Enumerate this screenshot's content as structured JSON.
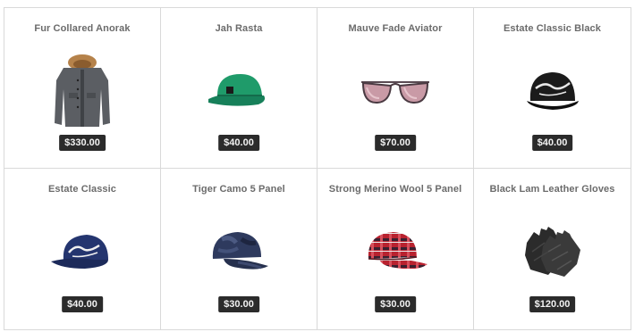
{
  "products": [
    {
      "name": "Fur Collared Anorak",
      "price": "$330.00",
      "icon": "anorak-jacket-icon"
    },
    {
      "name": "Jah Rasta",
      "price": "$40.00",
      "icon": "green-cap-icon"
    },
    {
      "name": "Mauve Fade Aviator",
      "price": "$70.00",
      "icon": "sunglasses-icon"
    },
    {
      "name": "Estate Classic Black",
      "price": "$40.00",
      "icon": "black-cap-icon"
    },
    {
      "name": "Estate Classic",
      "price": "$40.00",
      "icon": "blue-cap-icon"
    },
    {
      "name": "Tiger Camo 5 Panel",
      "price": "$30.00",
      "icon": "camo-cap-icon"
    },
    {
      "name": "Strong Merino Wool 5 Panel",
      "price": "$30.00",
      "icon": "plaid-cap-icon"
    },
    {
      "name": "Black Lam Leather Gloves",
      "price": "$120.00",
      "icon": "leather-gloves-icon"
    }
  ]
}
